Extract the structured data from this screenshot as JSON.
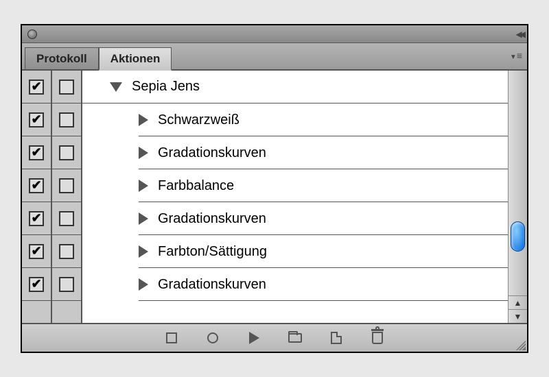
{
  "tabs": {
    "protokoll": "Protokoll",
    "aktionen": "Aktionen"
  },
  "action_set": {
    "name": "Sepia Jens",
    "expanded": true,
    "enabled": true
  },
  "steps": [
    {
      "name": "Schwarzweiß",
      "enabled": true,
      "dialog": false
    },
    {
      "name": "Gradationskurven",
      "enabled": true,
      "dialog": false
    },
    {
      "name": "Farbbalance",
      "enabled": true,
      "dialog": false
    },
    {
      "name": "Gradationskurven",
      "enabled": true,
      "dialog": false
    },
    {
      "name": "Farbton/Sättigung",
      "enabled": true,
      "dialog": false
    },
    {
      "name": "Gradationskurven",
      "enabled": true,
      "dialog": false
    }
  ],
  "icons": {
    "stop": "stop",
    "record": "record",
    "play": "play",
    "new_set": "new-set",
    "new_action": "new-action",
    "trash": "trash"
  }
}
